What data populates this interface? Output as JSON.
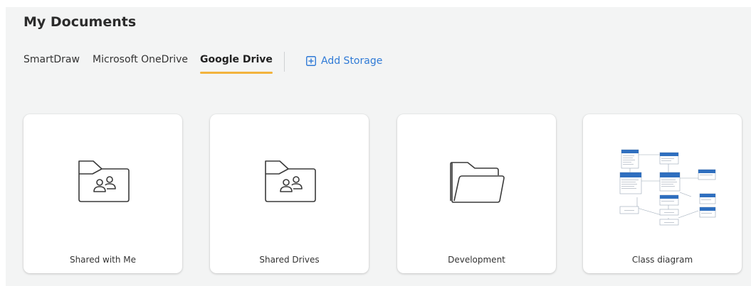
{
  "page": {
    "title": "My Documents"
  },
  "tabs": [
    {
      "label": "SmartDraw",
      "active": false
    },
    {
      "label": "Microsoft OneDrive",
      "active": false
    },
    {
      "label": "Google Drive",
      "active": true
    }
  ],
  "add_storage": {
    "label": "Add Storage",
    "icon": "plus-square-icon"
  },
  "cards": [
    {
      "label": "Shared with Me",
      "icon": "shared-folder-icon"
    },
    {
      "label": "Shared Drives",
      "icon": "shared-folder-icon"
    },
    {
      "label": "Development",
      "icon": "open-folder-icon"
    },
    {
      "label": "Class diagram",
      "icon": "class-diagram-thumbnail"
    }
  ],
  "colors": {
    "accent_underline": "#f2b33d",
    "link": "#2f7ad6",
    "panel_bg": "#f3f4f4"
  }
}
